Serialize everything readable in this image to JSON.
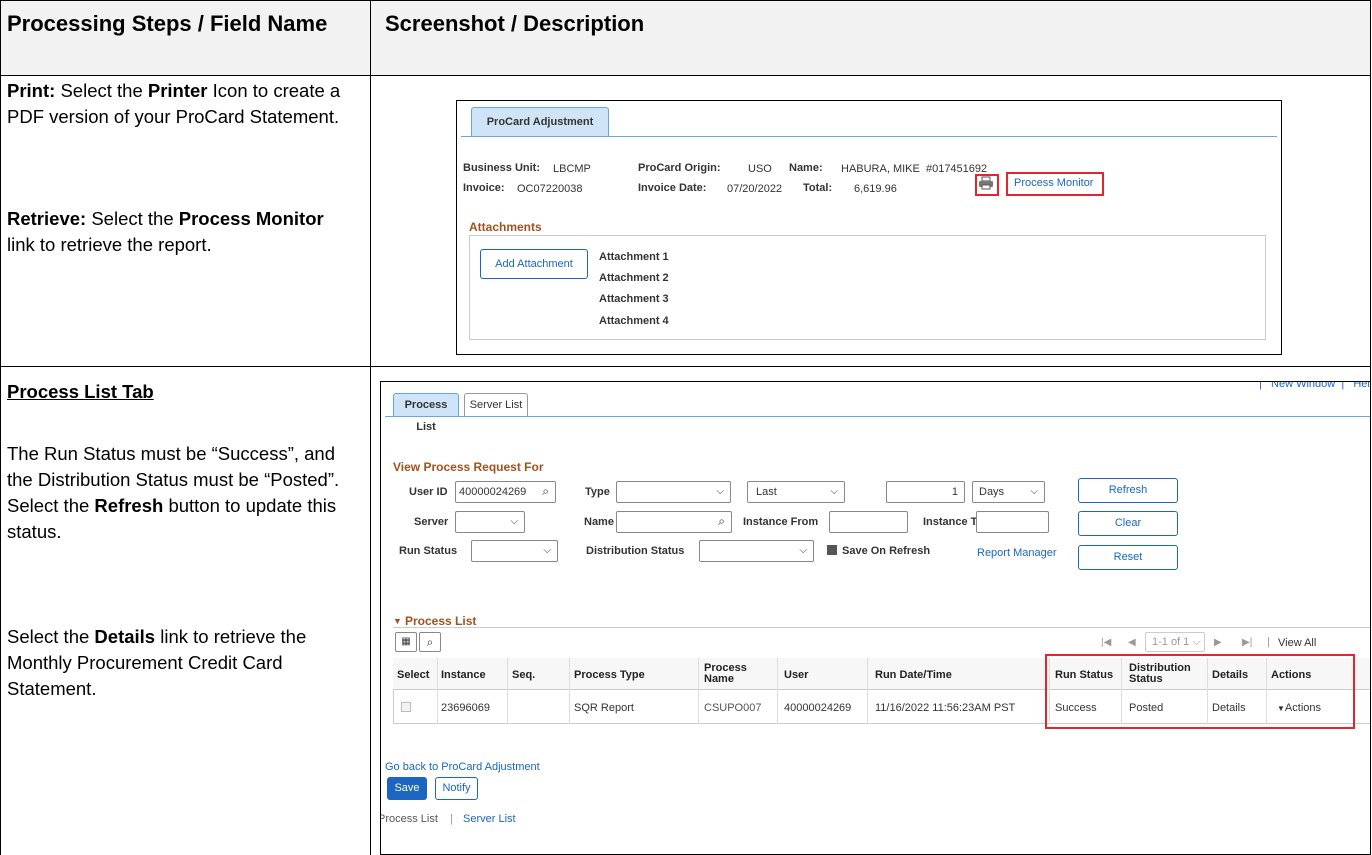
{
  "table": {
    "header_left": "Processing Steps / Field Name",
    "header_right": "Screenshot / Description"
  },
  "row1": {
    "print_label": "Print:",
    "print_text_a": " Select the ",
    "print_bold": "Printer",
    "print_text_b": " Icon to create a PDF version of your ProCard Statement.",
    "retrieve_label": "Retrieve:",
    "retrieve_text_a": " Select the ",
    "retrieve_bold": "Process Monitor",
    "retrieve_text_b": " link to retrieve the report."
  },
  "procard": {
    "tab": "ProCard Adjustment",
    "bu_label": "Business Unit:",
    "bu_value": "LBCMP",
    "origin_label": "ProCard Origin:",
    "origin_value": "USO",
    "name_label": "Name:",
    "name_value": "HABURA, MIKE  #017451692",
    "invoice_label": "Invoice:",
    "invoice_value": "OC07220038",
    "invdate_label": "Invoice Date:",
    "invdate_value": "07/20/2022",
    "total_label": "Total:",
    "total_value": "6,619.96",
    "process_monitor": "Process Monitor",
    "attachments_title": "Attachments",
    "add_attachment": "Add Attachment",
    "attachments": [
      "Attachment 1",
      "Attachment 2",
      "Attachment 3",
      "Attachment 4"
    ]
  },
  "row2": {
    "title": "Process List Tab",
    "p1_a": "The Run Status must be “Success”, and the Distribution Status must be “Posted”. Select the ",
    "p1_bold": "Refresh",
    "p1_b": " button to update this status.",
    "p2_a": "Select the ",
    "p2_bold": "Details",
    "p2_b": " link to retrieve the Monthly Procurement Credit Card Statement."
  },
  "pm": {
    "top_links": "|   New Window  |   Help  |",
    "tab_process_list": "Process List",
    "tab_server_list": "Server List",
    "view_for": "View Process Request For",
    "userid_label": "User ID",
    "userid_value": "40000024269",
    "type_label": "Type",
    "type_value": "",
    "last_value": "Last",
    "num_value": "1",
    "days_value": "Days",
    "refresh": "Refresh",
    "server_label": "Server",
    "name_label": "Name",
    "inst_from_label": "Instance From",
    "inst_to_label": "Instance To",
    "clear": "Clear",
    "runstatus_label": "Run Status",
    "diststatus_label": "Distribution Status",
    "save_on_refresh": "Save On Refresh",
    "report_manager": "Report Manager",
    "reset": "Reset",
    "process_list_title": "Process List",
    "pager": "1-1 of 1",
    "view_all": "View All",
    "columns": [
      "Select",
      "Instance",
      "Seq.",
      "Process Type",
      "Process Name",
      "User",
      "Run Date/Time",
      "Run Status",
      "Distribution Status",
      "Details",
      "Actions"
    ],
    "row": {
      "instance": "23696069",
      "seq": "",
      "process_type": "SQR Report",
      "process_name": "CSUPO007",
      "user": "40000024269",
      "run_datetime": "11/16/2022 11:56:23AM PST",
      "run_status": "Success",
      "dist_status": "Posted",
      "details": "Details",
      "actions": "Actions"
    },
    "go_back": "Go back to ProCard Adjustment",
    "save": "Save",
    "notify": "Notify",
    "footer_process_list": "Process List",
    "footer_server_list": "Server List"
  }
}
